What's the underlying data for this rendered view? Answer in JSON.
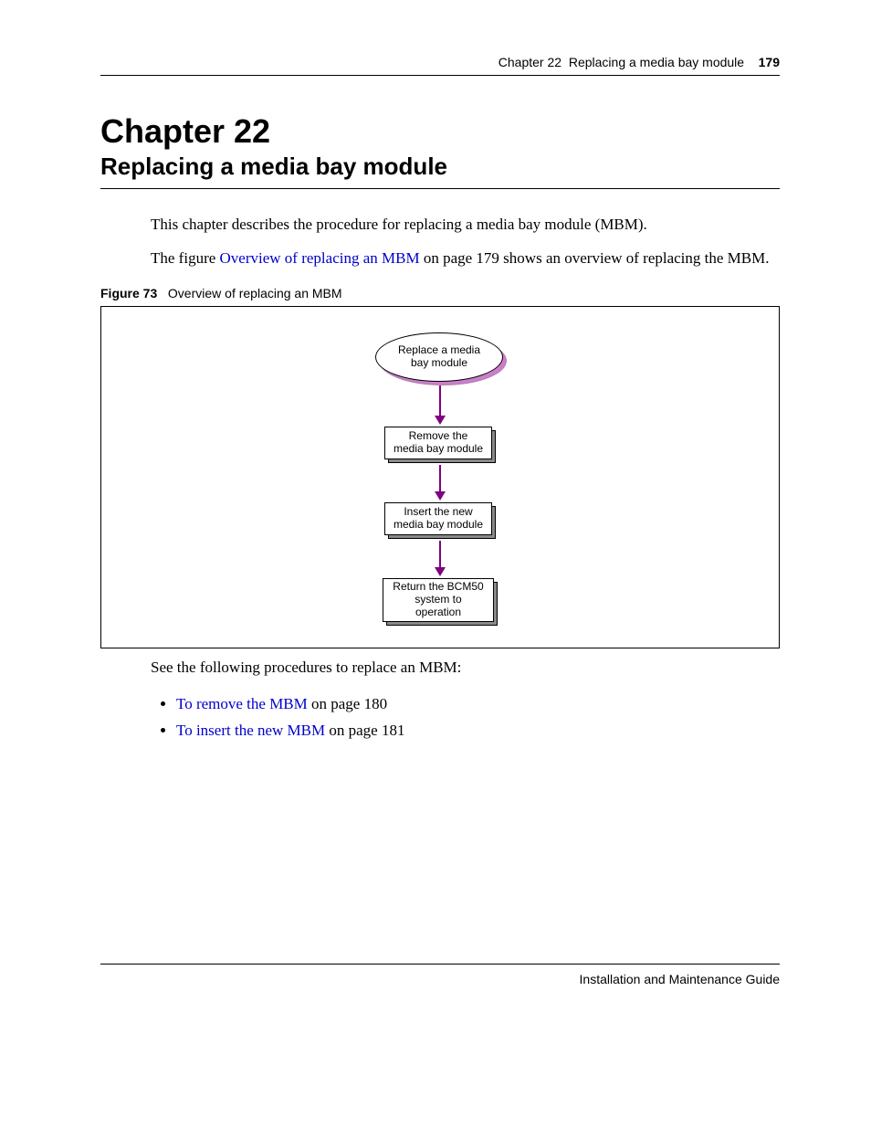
{
  "header": {
    "chapter_ref": "Chapter 22",
    "chapter_subject": "Replacing a media bay module",
    "page_number": "179"
  },
  "headings": {
    "chapter": "Chapter 22",
    "title": "Replacing a media bay module"
  },
  "paragraphs": {
    "intro": "This chapter describes the procedure for replacing a media bay module (MBM).",
    "fig_ref_pre": "The figure ",
    "fig_ref_link": "Overview of replacing an MBM",
    "fig_ref_post": " on page 179 shows an overview of replacing the MBM.",
    "see_following": "See the following procedures to replace an MBM:"
  },
  "figure": {
    "label": "Figure 73",
    "caption": "Overview of replacing an MBM",
    "nodes": {
      "n1": "Replace a media\nbay module",
      "n2": "Remove the\nmedia bay module",
      "n3": "Insert the new\nmedia bay module",
      "n4": "Return the BCM50\nsystem to\noperation"
    }
  },
  "procedures": [
    {
      "link": "To remove the MBM",
      "suffix": " on page 180"
    },
    {
      "link": "To insert the new MBM",
      "suffix": " on page 181"
    }
  ],
  "footer": "Installation and Maintenance Guide"
}
